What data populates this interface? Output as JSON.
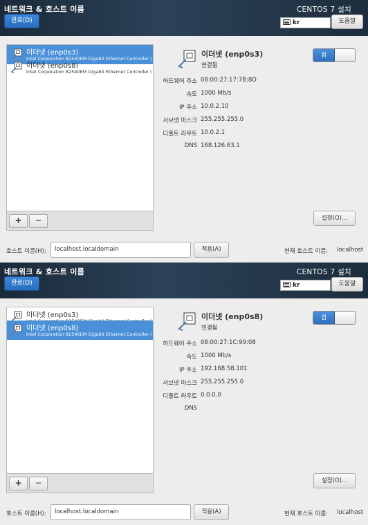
{
  "screens": [
    {
      "header": {
        "title": "네트워크 & 호스트 이름",
        "done_label": "완료(D)",
        "product": "CENTOS 7 설치",
        "keyboard_layout": "kr",
        "help_label": "도움말"
      },
      "interfaces": [
        {
          "name": "이더넷 (enp0s3)",
          "desc": "Intel Corporation 82540EM Gigabit Ethernet Controller (",
          "selected": true
        },
        {
          "name": "이더넷 (enp0s8)",
          "desc": "Intel Corporation 82540EM Gigabit Ethernet Controller (",
          "selected": false
        }
      ],
      "list_buttons": {
        "add": "+",
        "remove": "−"
      },
      "detail": {
        "name": "이더넷 (enp0s3)",
        "status": "연결됨",
        "toggle_label": "켬",
        "toggle_on": true,
        "fields": [
          {
            "label": "하드웨어 주소",
            "value": "08:00:27:17:7B:8D"
          },
          {
            "label": "속도",
            "value": "1000 Mb/s"
          },
          {
            "label": "IP 주소",
            "value": "10.0.2.10"
          },
          {
            "label": "서브넷 마스크",
            "value": "255.255.255.0"
          },
          {
            "label": "디폴트 라우트",
            "value": "10.0.2.1"
          },
          {
            "label": "DNS",
            "value": "168.126.63.1"
          }
        ],
        "settings_label": "설정(O)..."
      },
      "hostname": {
        "label": "호스트 이름(H):",
        "value": "localhost.localdomain",
        "apply_label": "적용(A)",
        "current_label": "현재 호스트 이름:",
        "current_value": "localhost"
      }
    },
    {
      "header": {
        "title": "네트워크 & 호스트 이름",
        "done_label": "완료(D)",
        "product": "CENTOS 7 설치",
        "keyboard_layout": "kr",
        "help_label": "도움말"
      },
      "interfaces": [
        {
          "name": "이더넷 (enp0s3)",
          "desc": "Intel Corporation 82540EM Gigabit Ethernet Controller (",
          "selected": false
        },
        {
          "name": "이더넷 (enp0s8)",
          "desc": "Intel Corporation 82540EM Gigabit Ethernet Controller (",
          "selected": true
        }
      ],
      "list_buttons": {
        "add": "+",
        "remove": "−"
      },
      "detail": {
        "name": "이더넷 (enp0s8)",
        "status": "연결됨",
        "toggle_label": "켬",
        "toggle_on": true,
        "fields": [
          {
            "label": "하드웨어 주소",
            "value": "08:00:27:1C:99:08"
          },
          {
            "label": "속도",
            "value": "1000 Mb/s"
          },
          {
            "label": "IP 주소",
            "value": "192.168.58.101"
          },
          {
            "label": "서브넷 마스크",
            "value": "255.255.255.0"
          },
          {
            "label": "디폴트 라우트",
            "value": "0.0.0.0"
          },
          {
            "label": "DNS",
            "value": ""
          }
        ],
        "settings_label": "설정(O)..."
      },
      "hostname": {
        "label": "호스트 이름(H):",
        "value": "localhost.localdomain",
        "apply_label": "적용(A)",
        "current_label": "현재 호스트 이름:",
        "current_value": "localhost"
      }
    }
  ]
}
